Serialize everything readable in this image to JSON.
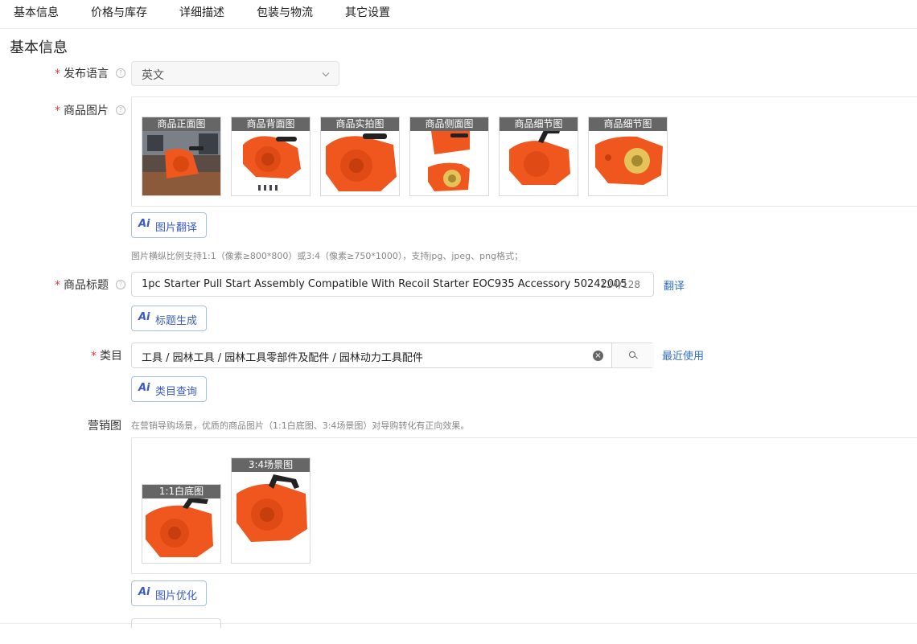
{
  "tabs": [
    "基本信息",
    "价格与库存",
    "详细描述",
    "包装与物流",
    "其它设置"
  ],
  "section_title": "基本信息",
  "form": {
    "required_mark": "*",
    "language": {
      "label": "发布语言",
      "value": "英文",
      "icon": "chevron-down-icon"
    },
    "images": {
      "label": "商品图片",
      "thumbs": [
        "商品正面图",
        "商品背面图",
        "商品实拍图",
        "商品侧面图",
        "商品细节图",
        "商品细节图"
      ],
      "ai_button": "图片翻译",
      "hint": "图片横纵比例支持1:1（像素≥800*800）或3:4（像素≥750*1000），支持jpg、jpeg、png格式；"
    },
    "title": {
      "label": "商品标题",
      "value": "1pc Starter Pull Start Assembly Compatible With Recoil Starter EOC935 Accessory 50242005",
      "count": "124/128",
      "translate_link": "翻译",
      "ai_button": "标题生成"
    },
    "category": {
      "label": "类目",
      "value": "工具 / 园林工具 / 园林工具零部件及配件 / 园林动力工具配件",
      "recent_link": "最近使用",
      "ai_button": "类目查询",
      "icons": [
        "clear-icon",
        "search-icon"
      ]
    },
    "marketing": {
      "label": "营销图",
      "hint": "在营销导购场景，优质的商品图片（1:1白底图、3:4场景图）对导购转化有正向效果。",
      "thumbs": [
        "1:1白底图",
        "3:4场景图"
      ],
      "ai_button": "图片优化"
    }
  },
  "ai_badge": "Ai",
  "colors": {
    "accent": "#3b5bbd",
    "link": "#2f6ec4",
    "required": "#e4393c",
    "product_orange": "#f0571f"
  }
}
